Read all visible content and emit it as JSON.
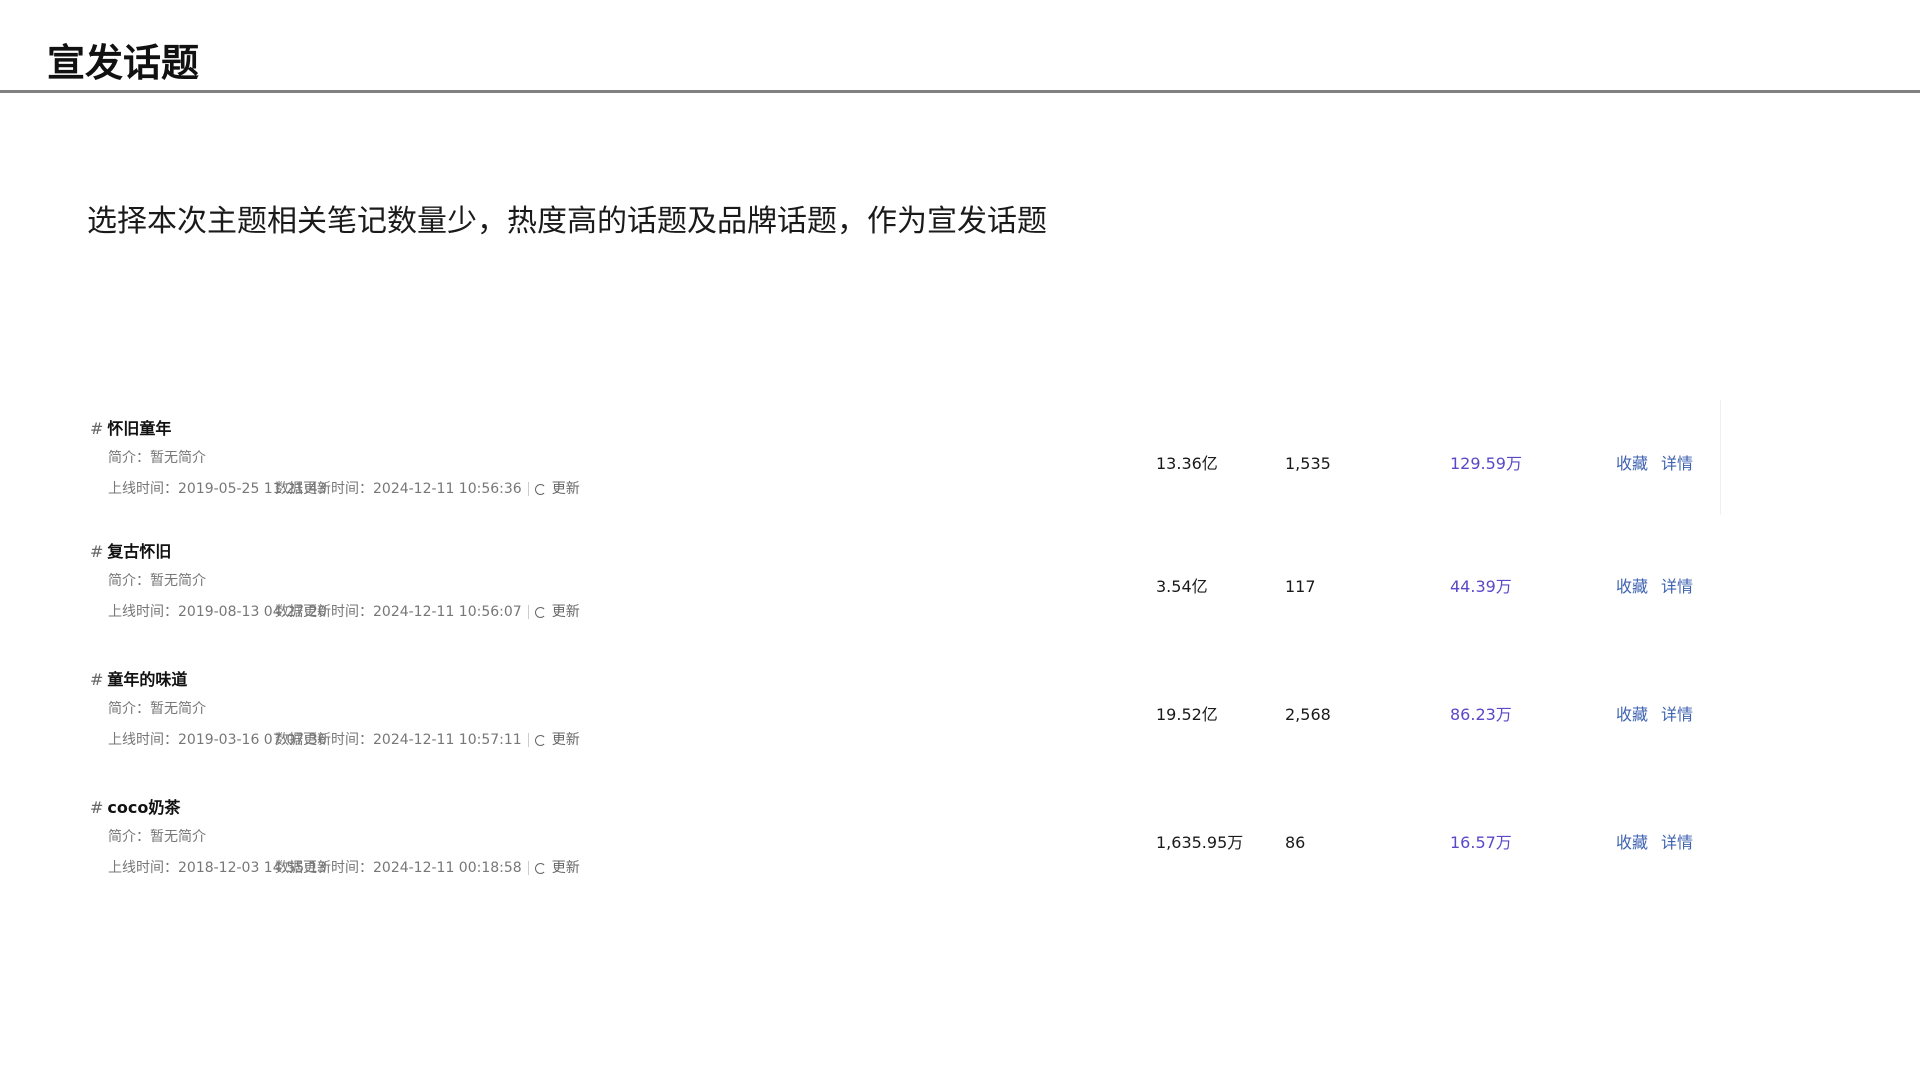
{
  "header": {
    "title": "宣发话题"
  },
  "description": "选择本次主题相关笔记数量少，热度高的话题及品牌话题，作为宣发话题",
  "labels": {
    "hash": "#",
    "intro_prefix": "简介：",
    "online_prefix": "上线时间：",
    "update_prefix": "数据更新时间：",
    "refresh": "更新",
    "favorite": "收藏",
    "detail": "详情"
  },
  "topics": [
    {
      "name": "怀旧童年",
      "intro": "暂无简介",
      "online_time": "2019-05-25 11:21:43",
      "update_time": "2024-12-11 10:56:36",
      "views": "13.36亿",
      "notes": "1,535",
      "interactions": "129.59万"
    },
    {
      "name": "复古怀旧",
      "intro": "暂无简介",
      "online_time": "2019-08-13 04:27:20",
      "update_time": "2024-12-11 10:56:07",
      "views": "3.54亿",
      "notes": "117",
      "interactions": "44.39万"
    },
    {
      "name": "童年的味道",
      "intro": "暂无简介",
      "online_time": "2019-03-16 07:07:36",
      "update_time": "2024-12-11 10:57:11",
      "views": "19.52亿",
      "notes": "2,568",
      "interactions": "86.23万"
    },
    {
      "name": "coco奶茶",
      "intro": "暂无简介",
      "online_time": "2018-12-03 14:55:13",
      "update_time": "2024-12-11 00:18:58",
      "views": "1,635.95万",
      "notes": "86",
      "interactions": "16.57万"
    }
  ],
  "colors": {
    "interaction_accent": "#5a48c8",
    "link": "#3f63b0",
    "rule": "#808080"
  }
}
